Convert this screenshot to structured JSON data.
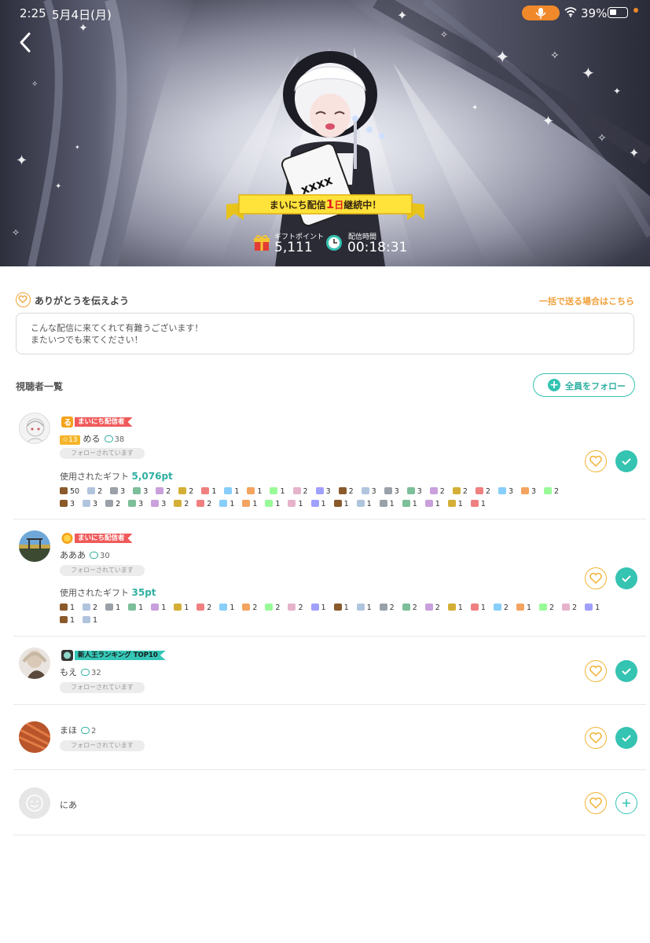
{
  "status_bar": {
    "time": "2:25",
    "date": "5月4日(月)",
    "battery": "39%"
  },
  "hero": {
    "banner_pre": "まいにち配信",
    "banner_num": "1",
    "banner_unit": "日",
    "banner_post": "継続中！",
    "gift_points_caption": "ギフトポイント",
    "gift_points_value": "5,111",
    "duration_caption": "配信時間",
    "duration_value": "00:18:31",
    "sign_text": "xxxx"
  },
  "thanks": {
    "title": "ありがとうを伝えよう",
    "bulk_link": "一括で送る場合はこちら",
    "message_line1": "こんな配信に来てくれて有難うございます！",
    "message_line2": "またいつでも来てください！"
  },
  "viewers_title": "視聴者一覧",
  "follow_all_label": "全員をフォロー",
  "viewers": [
    {
      "badge": "まいにち配信者",
      "level": "13",
      "name": "める",
      "comments": "38",
      "followed": "フォローされています",
      "gift_label": "使用されたギフト",
      "gift_total": "5,076pt",
      "gifts_line1": [
        "50",
        "2",
        "3",
        "3",
        "2",
        "2",
        "1",
        "1",
        "1",
        "1",
        "2",
        "3",
        "2",
        "3",
        "3",
        "3",
        "2",
        "2",
        "2",
        "3",
        "3",
        "2"
      ],
      "gifts_line2": [
        "3",
        "3",
        "2",
        "3",
        "3",
        "2",
        "2",
        "1",
        "1",
        "1",
        "1",
        "1",
        "1",
        "1",
        "1",
        "1",
        "1",
        "1",
        "1"
      ]
    },
    {
      "badge": "まいにち配信者",
      "name": "あああ",
      "comments": "30",
      "followed": "フォローされています",
      "gift_label": "使用されたギフト",
      "gift_total": "35pt",
      "gifts_line1": [
        "1",
        "2",
        "1",
        "1",
        "1",
        "1",
        "2",
        "1",
        "2",
        "2",
        "2",
        "1",
        "1",
        "1",
        "2",
        "2",
        "2",
        "1",
        "1",
        "2",
        "1",
        "2",
        "2",
        "1"
      ],
      "gifts_line2": [
        "1",
        "1"
      ]
    },
    {
      "badge": "新人王ランキング TOP10",
      "name": "もえ",
      "comments": "32",
      "followed": "フォローされています"
    },
    {
      "name": "まほ",
      "comments": "2",
      "followed": "フォローされています"
    },
    {
      "name": "にあ"
    }
  ],
  "colors": {
    "accent_teal": "#35c3b2",
    "accent_orange": "#f0a03a",
    "badge_red": "#f05a5a",
    "heart_gold": "#f0b233"
  }
}
